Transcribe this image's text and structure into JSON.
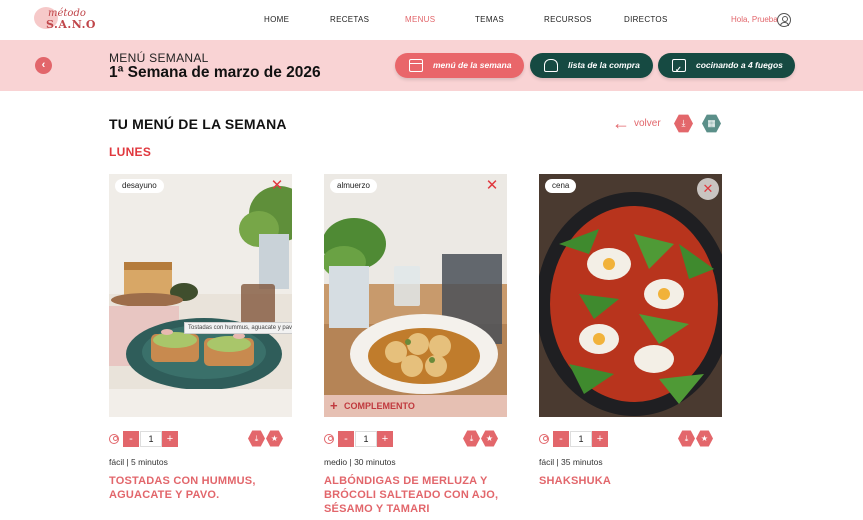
{
  "logo": {
    "line1": "método",
    "line2": "S.A.N.O"
  },
  "nav": [
    {
      "label": "HOME",
      "active": false
    },
    {
      "label": "RECETAS",
      "active": false
    },
    {
      "label": "MENUS",
      "active": true
    },
    {
      "label": "TEMAS",
      "active": false
    },
    {
      "label": "RECURSOS",
      "active": false
    },
    {
      "label": "DIRECTOS",
      "active": false
    }
  ],
  "user": {
    "greeting": "Hola, Prueba",
    "icon": "user-icon"
  },
  "banner": {
    "subtitle": "MENÚ SEMANAL",
    "title": "1ª Semana de marzo de 2026",
    "back_icon": "chevron-left-icon",
    "buttons": [
      {
        "label": "menú de la semana",
        "icon": "calendar-icon",
        "color": "#e9666a"
      },
      {
        "label": "lista de la compra",
        "icon": "chef-hat-icon",
        "color": "#164a42"
      },
      {
        "label": "cocinando a 4 fuegos",
        "icon": "clipboard-icon",
        "color": "#164a42"
      }
    ]
  },
  "section": {
    "title": "TU MENÚ DE LA SEMANA",
    "volver": "volver",
    "day": "LUNES"
  },
  "cards": [
    {
      "tag": "desayuno",
      "quantity": "1",
      "meta": "fácil | 5 minutos",
      "name": "TOSTADAS CON HUMMUS, AGUACATE Y PAVO.",
      "tooltip": "Tostadas con hummus, aguacate y pavo."
    },
    {
      "tag": "almuerzo",
      "quantity": "1",
      "meta": "medio | 30 minutos",
      "name": "ALBÓNDIGAS DE MERLUZA Y BRÓCOLI SALTEADO CON AJO, SÉSAMO Y TAMARI",
      "complemento": "COMPLEMENTO"
    },
    {
      "tag": "cena",
      "quantity": "1",
      "meta": "fácil | 35 minutos",
      "name": "SHAKSHUKA"
    }
  ],
  "colors": {
    "accent": "#e2666b",
    "banner_bg": "#f9d3d4",
    "dark_green": "#164a42",
    "day_red": "#e0383e"
  }
}
